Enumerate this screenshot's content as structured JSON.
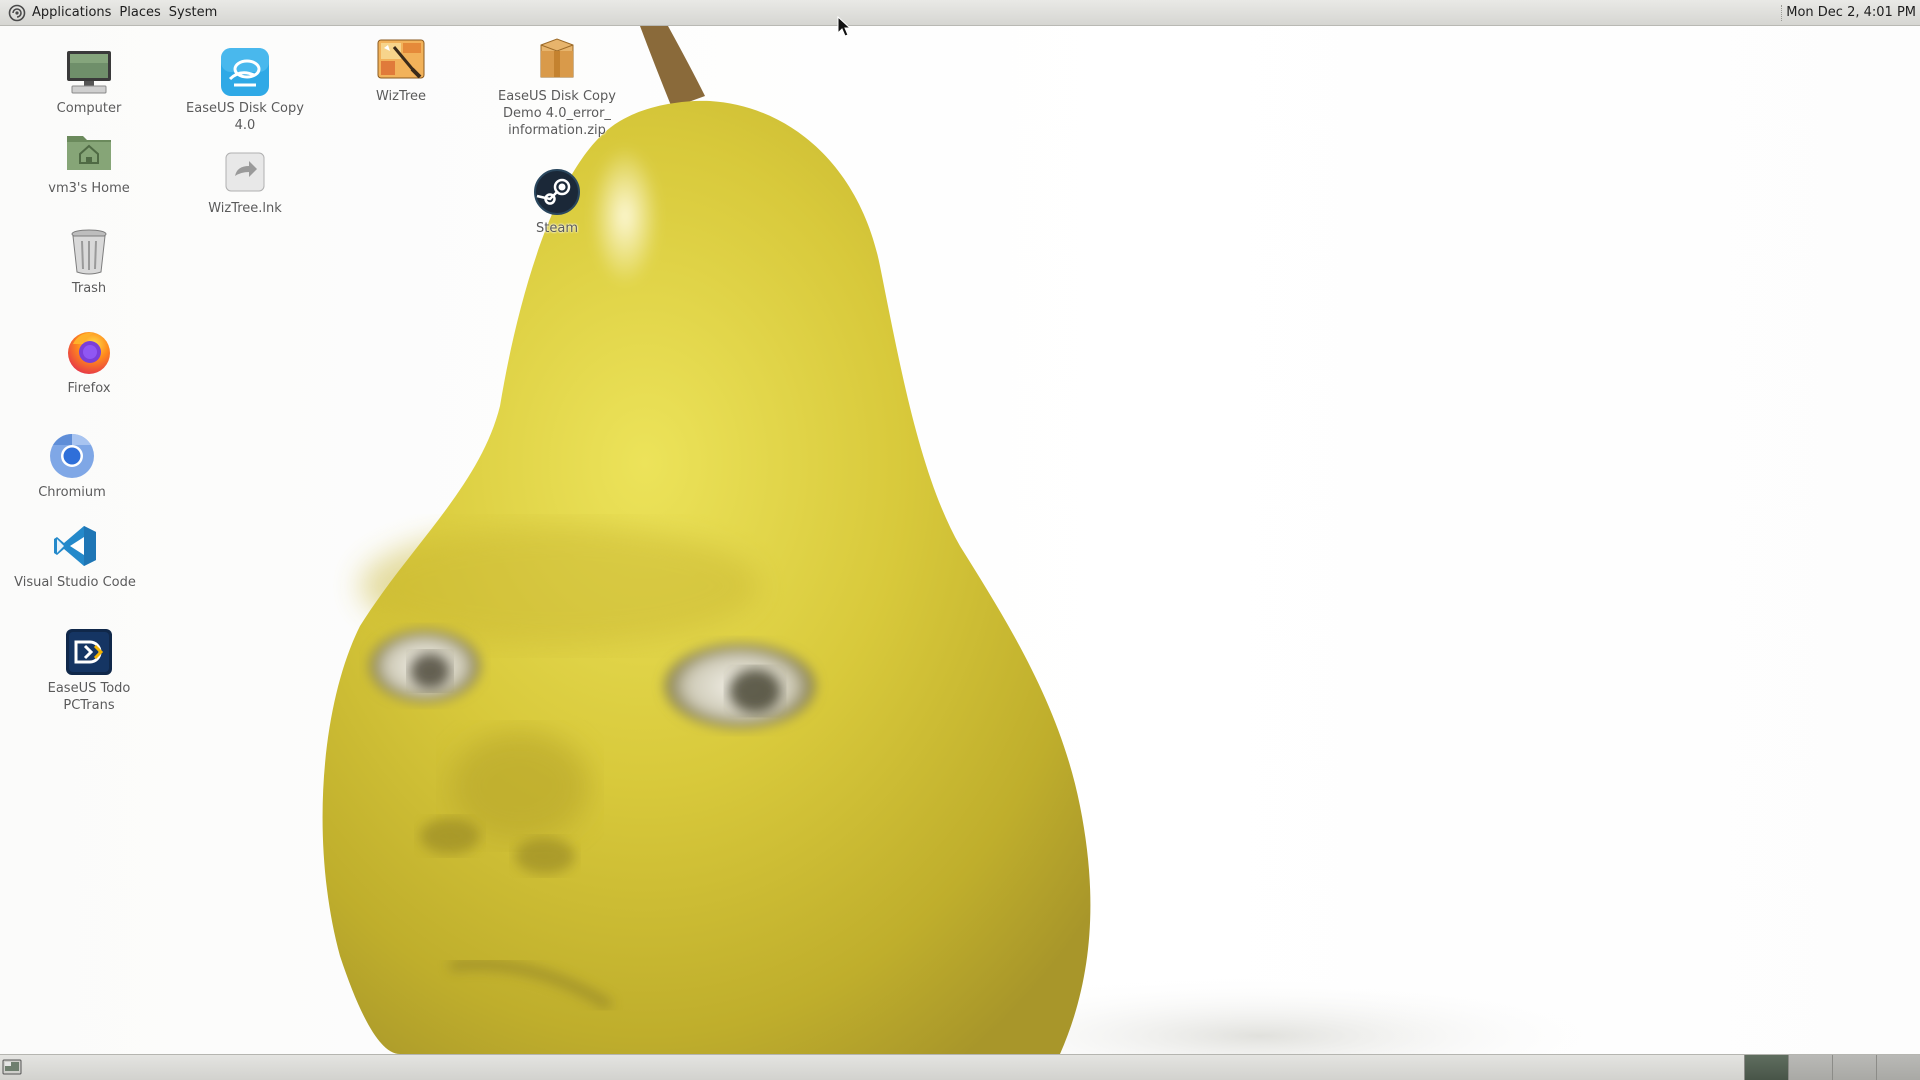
{
  "top_panel": {
    "menus": [
      "Applications",
      "Places",
      "System"
    ],
    "clock": "Mon Dec 2,  4:01 PM"
  },
  "desktop_icons": [
    {
      "name": "computer",
      "icon": "computer-icon",
      "label": "Computer"
    },
    {
      "name": "home",
      "icon": "home-folder-icon",
      "label": "vm3's Home"
    },
    {
      "name": "trash",
      "icon": "trash-icon",
      "label": "Trash"
    },
    {
      "name": "firefox",
      "icon": "firefox-icon",
      "label": "Firefox"
    },
    {
      "name": "chromium",
      "icon": "chromium-icon",
      "label": "Chromium"
    },
    {
      "name": "vscode",
      "icon": "vscode-icon",
      "label": "Visual Studio Code"
    },
    {
      "name": "easeus-todo-pctrans",
      "icon": "pctrans-icon",
      "label": "EaseUS Todo PCTrans"
    },
    {
      "name": "easeus-disk-copy",
      "icon": "disk-copy-icon",
      "label": "EaseUS Disk Copy 4.0"
    },
    {
      "name": "wiztree-lnk",
      "icon": "shortcut-link-icon",
      "label": "WizTree.lnk"
    },
    {
      "name": "wiztree",
      "icon": "wiztree-icon",
      "label": "WizTree"
    },
    {
      "name": "easeus-zip",
      "icon": "zip-archive-icon",
      "label": "EaseUS Disk Copy\nDemo 4.0_error_\ninformation.zip"
    },
    {
      "name": "steam",
      "icon": "steam-icon",
      "label": "Steam"
    }
  ],
  "bottom_panel": {
    "workspace_count": 4,
    "active_workspace": 1
  },
  "colors": {
    "panel": "#dcdcd8",
    "pear": "#d2c43a",
    "workspace_active": "#556255"
  }
}
